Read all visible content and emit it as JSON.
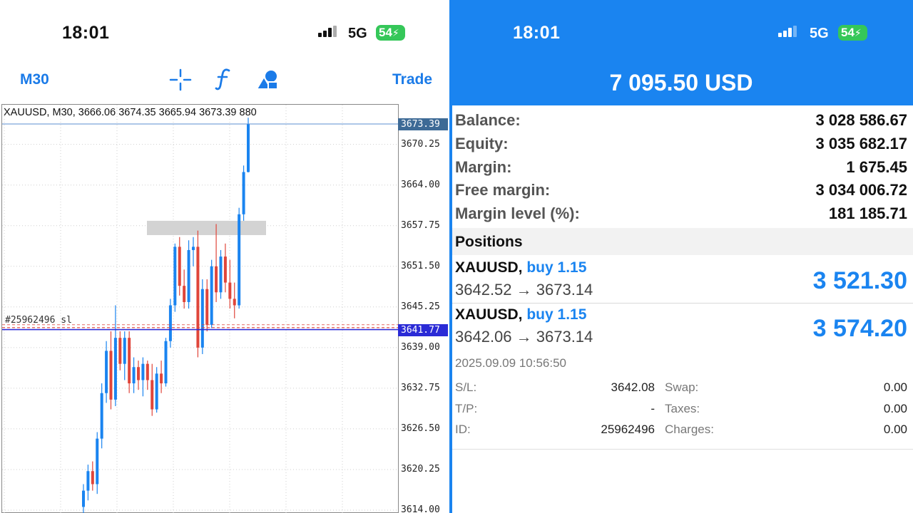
{
  "left": {
    "status": {
      "time": "18:01",
      "network": "5G",
      "battery": "54"
    },
    "toolbar": {
      "timeframe": "M30",
      "trade": "Trade"
    },
    "chart": {
      "info": "XAUUSD, M30, 3666.06 3674.35 3665.94 3673.39 880",
      "ticket_text": "#25962496 sl",
      "current_price": "3673.39",
      "position_price": "3641.77",
      "price_labels": [
        "3670.25",
        "3664.00",
        "3657.75",
        "3651.50",
        "3645.25",
        "3639.00",
        "3632.75",
        "3626.50",
        "3620.25",
        "3614.00"
      ]
    },
    "colors": {
      "bull": "#1a84f0",
      "bear": "#e0453a",
      "position_line": "#2b2bd6",
      "current_badge": "#3d6a96",
      "accent": "#1b7be8"
    }
  },
  "chart_data": {
    "type": "candlestick",
    "symbol": "XAUUSD",
    "timeframe": "M30",
    "ylim": [
      3614.0,
      3676.0
    ],
    "y_ticks": [
      3670.25,
      3664.0,
      3657.75,
      3651.5,
      3645.25,
      3639.0,
      3632.75,
      3626.5,
      3620.25,
      3614.0
    ],
    "current_price": 3673.39,
    "position_line": 3641.77,
    "resistance_zone": [
      3656.3,
      3658.5
    ],
    "candles": [
      {
        "o": 3614.5,
        "h": 3618.0,
        "l": 3612.0,
        "c": 3617.0
      },
      {
        "o": 3617.0,
        "h": 3621.0,
        "l": 3615.5,
        "c": 3620.0
      },
      {
        "o": 3620.0,
        "h": 3621.5,
        "l": 3617.0,
        "c": 3618.0
      },
      {
        "o": 3618.0,
        "h": 3626.0,
        "l": 3616.5,
        "c": 3625.0
      },
      {
        "o": 3625.0,
        "h": 3633.5,
        "l": 3623.5,
        "c": 3632.0
      },
      {
        "o": 3632.0,
        "h": 3640.0,
        "l": 3630.5,
        "c": 3638.5
      },
      {
        "o": 3638.5,
        "h": 3641.5,
        "l": 3629.5,
        "c": 3631.0
      },
      {
        "o": 3631.0,
        "h": 3645.5,
        "l": 3630.0,
        "c": 3640.5
      },
      {
        "o": 3640.5,
        "h": 3641.5,
        "l": 3635.5,
        "c": 3636.5
      },
      {
        "o": 3636.5,
        "h": 3641.5,
        "l": 3634.0,
        "c": 3640.5
      },
      {
        "o": 3640.5,
        "h": 3641.5,
        "l": 3632.0,
        "c": 3633.5
      },
      {
        "o": 3633.5,
        "h": 3637.5,
        "l": 3632.0,
        "c": 3636.0
      },
      {
        "o": 3636.0,
        "h": 3637.0,
        "l": 3632.5,
        "c": 3634.0
      },
      {
        "o": 3634.0,
        "h": 3637.5,
        "l": 3631.5,
        "c": 3636.5
      },
      {
        "o": 3636.5,
        "h": 3637.0,
        "l": 3632.5,
        "c": 3634.0
      },
      {
        "o": 3634.0,
        "h": 3636.5,
        "l": 3628.5,
        "c": 3629.5
      },
      {
        "o": 3629.5,
        "h": 3636.0,
        "l": 3629.0,
        "c": 3635.0
      },
      {
        "o": 3635.0,
        "h": 3637.0,
        "l": 3632.0,
        "c": 3633.5
      },
      {
        "o": 3633.5,
        "h": 3640.5,
        "l": 3633.0,
        "c": 3640.0
      },
      {
        "o": 3640.0,
        "h": 3646.5,
        "l": 3639.0,
        "c": 3645.5
      },
      {
        "o": 3645.5,
        "h": 3655.0,
        "l": 3644.5,
        "c": 3654.5
      },
      {
        "o": 3654.5,
        "h": 3656.0,
        "l": 3647.0,
        "c": 3648.5
      },
      {
        "o": 3648.5,
        "h": 3651.0,
        "l": 3645.0,
        "c": 3646.0
      },
      {
        "o": 3646.0,
        "h": 3655.5,
        "l": 3645.0,
        "c": 3654.0
      },
      {
        "o": 3654.0,
        "h": 3656.0,
        "l": 3651.5,
        "c": 3654.5
      },
      {
        "o": 3654.5,
        "h": 3657.0,
        "l": 3637.5,
        "c": 3639.0
      },
      {
        "o": 3639.0,
        "h": 3649.5,
        "l": 3638.0,
        "c": 3648.0
      },
      {
        "o": 3648.0,
        "h": 3649.5,
        "l": 3641.5,
        "c": 3642.5
      },
      {
        "o": 3642.5,
        "h": 3652.5,
        "l": 3642.0,
        "c": 3651.5
      },
      {
        "o": 3651.5,
        "h": 3658.0,
        "l": 3646.0,
        "c": 3647.5
      },
      {
        "o": 3647.5,
        "h": 3654.0,
        "l": 3646.5,
        "c": 3653.0
      },
      {
        "o": 3653.0,
        "h": 3655.0,
        "l": 3647.5,
        "c": 3649.0
      },
      {
        "o": 3649.0,
        "h": 3652.5,
        "l": 3645.0,
        "c": 3646.5
      },
      {
        "o": 3646.5,
        "h": 3649.0,
        "l": 3643.5,
        "c": 3645.5
      },
      {
        "o": 3645.5,
        "h": 3660.5,
        "l": 3645.0,
        "c": 3659.5
      },
      {
        "o": 3659.5,
        "h": 3667.0,
        "l": 3658.5,
        "c": 3666.0
      },
      {
        "o": 3666.0,
        "h": 3674.35,
        "l": 3665.94,
        "c": 3673.39
      }
    ]
  },
  "right": {
    "status": {
      "time": "18:01",
      "network": "5G",
      "battery": "54"
    },
    "total": "7 095.50 USD",
    "account": [
      {
        "label": "Balance:",
        "value": "3 028 586.67"
      },
      {
        "label": "Equity:",
        "value": "3 035 682.17"
      },
      {
        "label": "Margin:",
        "value": "1 675.45"
      },
      {
        "label": "Free margin:",
        "value": "3 034 006.72"
      },
      {
        "label": "Margin level (%):",
        "value": "181 185.71"
      }
    ],
    "positions_title": "Positions",
    "positions": [
      {
        "symbol": "XAUUSD,",
        "side": "buy 1.15",
        "prices": "3642.52 → 3673.14",
        "profit": "3 521.30"
      },
      {
        "symbol": "XAUUSD,",
        "side": "buy 1.15",
        "prices": "3642.06 → 3673.14",
        "profit": "3 574.20"
      }
    ],
    "detail": {
      "date": "2025.09.09 10:56:50",
      "sl_label": "S/L:",
      "sl_value": "3642.08",
      "tp_label": "T/P:",
      "tp_value": "-",
      "id_label": "ID:",
      "id_value": "25962496",
      "swap_label": "Swap:",
      "swap_value": "0.00",
      "taxes_label": "Taxes:",
      "taxes_value": "0.00",
      "charges_label": "Charges:",
      "charges_value": "0.00"
    }
  }
}
